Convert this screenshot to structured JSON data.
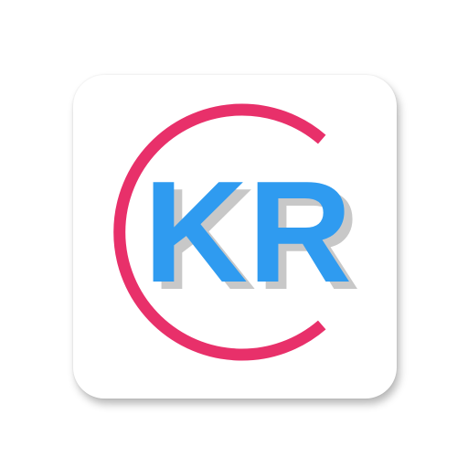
{
  "app_icon": {
    "logo_text": "KR",
    "colors": {
      "ring": "#e8306a",
      "letters": "#2f9bf0",
      "letter_shadow": "#c8c8c8",
      "background": "#ffffff"
    }
  }
}
